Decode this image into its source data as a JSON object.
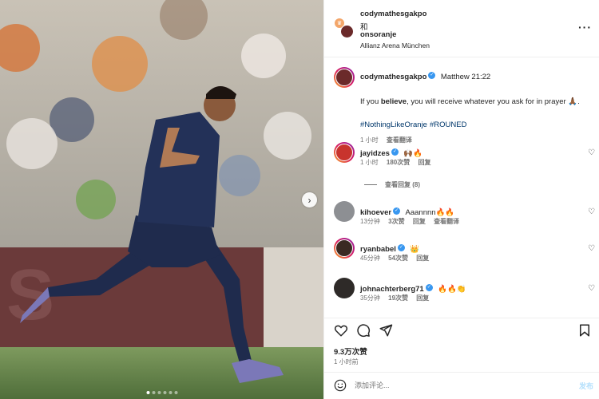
{
  "header": {
    "author": "codymathesgakpo",
    "and": "和",
    "collaborator": "onsoranje",
    "location": "Allianz Arena München",
    "more_label": "···"
  },
  "caption": {
    "username": "codymathesgakpo",
    "verse": "Matthew 21:22",
    "text_before": "If you ",
    "text_bold": "believe",
    "text_after": ", you will receive whatever you ask for in prayer 🙏🏾.",
    "hashtags": [
      "#NothingLikeOranje",
      "#ROUNED"
    ],
    "time": "1 小时",
    "translate": "查看翻译"
  },
  "comments": [
    {
      "username": "jayidzes",
      "verified": true,
      "text": "🙌🏾🔥",
      "time": "1 小时",
      "likes": "180次赞",
      "reply": "回复",
      "translate": "",
      "view_replies": "查看回复 (8)"
    },
    {
      "username": "kihoever",
      "verified": true,
      "text": "Aaannnn🔥🔥",
      "time": "13分钟",
      "likes": "3次赞",
      "reply": "回复",
      "translate": "查看翻译",
      "view_replies": ""
    },
    {
      "username": "ryanbabel",
      "verified": true,
      "text": "👑",
      "time": "45分钟",
      "likes": "54次赞",
      "reply": "回复",
      "translate": "",
      "view_replies": ""
    },
    {
      "username": "johnachterberg71",
      "verified": true,
      "text": "🔥🔥👏",
      "time": "35分钟",
      "likes": "19次赞",
      "reply": "回复",
      "translate": "",
      "view_replies": ""
    }
  ],
  "actions": {
    "likes": "9.3万次赞",
    "time": "1 小时前"
  },
  "add_comment": {
    "placeholder": "添加评论...",
    "post_label": "发布"
  },
  "icons": {
    "heart": "heart-icon",
    "comment": "comment-icon",
    "share": "share-icon",
    "save": "bookmark-icon",
    "emoji": "emoji-icon",
    "verified": "verified-badge-icon",
    "next": "chevron-right-icon"
  },
  "colors": {
    "link": "#00376b",
    "verified": "#3897f0",
    "jersey": "#1f2b4d",
    "pitch": "#6e8f4e"
  }
}
